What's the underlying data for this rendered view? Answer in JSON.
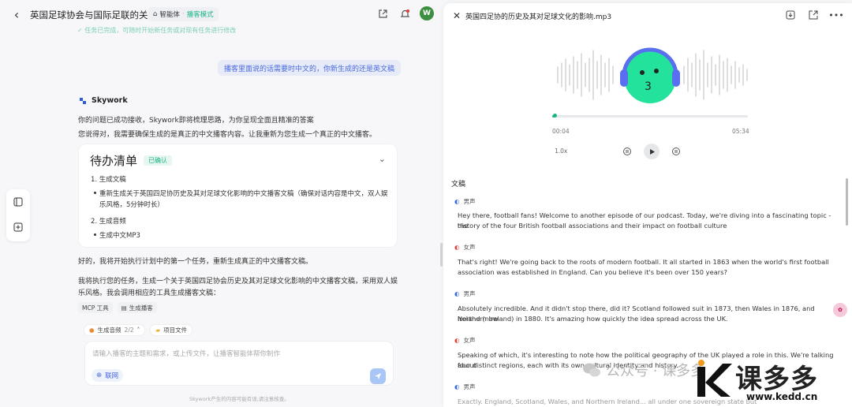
{
  "header": {
    "title": "英国足球协会与国际足联的关系",
    "mode_primary": "智能体",
    "mode_secondary": "播客模式",
    "avatar_letter": "W"
  },
  "notice": "任务已完成，可随时开始新任务或对现有任务进行修改",
  "user_message": "播客里面说的话需要时中文的，你新生成的还是英文稿",
  "assistant": {
    "brand": "Skywork",
    "line1": "你的问题已成功接收，Skywork即将梳理思路，为你呈现全面且精准的答案",
    "line2": "您说得对，我需要确保生成的是真正的中文播客内容。让我重新为您生成一个真正的中文播客。",
    "todo": {
      "title": "待办清单",
      "badge": "已确认",
      "step1": "1. 生成文稿",
      "step1_detail_a": "重新生成关于英国四足协历史及其对足球文化影响的中文播客文稿（确保对话内容是中文，双人娱",
      "step1_detail_b": "乐风格，5分钟时长）",
      "step2": "2. 生成音频",
      "step2_detail": "生成中文MP3"
    },
    "line3": "好的，我将开始执行计划中的第一个任务，重新生成真正的中文播客文稿。",
    "line4": "我将执行您的任务，生成一个关于英国四足协会历史及其对足球文化影响的中文播客文稿，采用双人娱",
    "line5": "乐风格。我会调用相应的工具生成播客文稿：",
    "tags": [
      "MCP 工具",
      "生成播客"
    ]
  },
  "composer": {
    "chip1_label": "生成音频",
    "chip1_count": "2/2",
    "chip2_label": "项目文件",
    "placeholder": "请输入播客的主题和需求，或上传文件，让播客智能体帮你制作",
    "network_label": "联网",
    "footnote": "Skywork产生的内容可能有误,请注意核查。"
  },
  "player": {
    "filename": "英国四足协的历史及其对足球文化的影响.mp3",
    "current_time": "00:04",
    "total_time": "05:34",
    "progress_fraction": 0.012,
    "speed": "1.0x",
    "accent_color": "#19b483"
  },
  "transcript": {
    "heading": "文稿",
    "entries": [
      {
        "speaker": "男声",
        "line1": "Hey there, football fans! Welcome to another episode of our podcast. Today, we're diving into a fascinating topic - the",
        "line2": "history of the four British football associations and their impact on football culture"
      },
      {
        "speaker": "女声",
        "line1": "That's right! We're going back to the roots of modern football. It all started in 1863 when the world's first football",
        "line2": "association was established in England. Can you believe it's been over 150 years?"
      },
      {
        "speaker": "男声",
        "line1": "Absolutely incredible. And it didn't stop there, did it? Scotland followed suit in 1873, then Wales in 1876, and Ireland (now",
        "line2": "Northern Ireland) in 1880. It's amazing how quickly the idea spread across the UK."
      },
      {
        "speaker": "女声",
        "line1": "Speaking of which, it's interesting to note how the political geography of the UK played a role in this. We're talking about",
        "line2": "four distinct regions, each with its own cultural identity and history."
      },
      {
        "speaker": "男声",
        "line1": "Exactly. England, Scotland, Wales, and Northern Ireland... all under one sovereign state but",
        "line2": ""
      }
    ]
  },
  "watermark": {
    "wechat_text": "公众号 · 课多多",
    "brand": "课多多",
    "url": "www.kedd.cn"
  }
}
